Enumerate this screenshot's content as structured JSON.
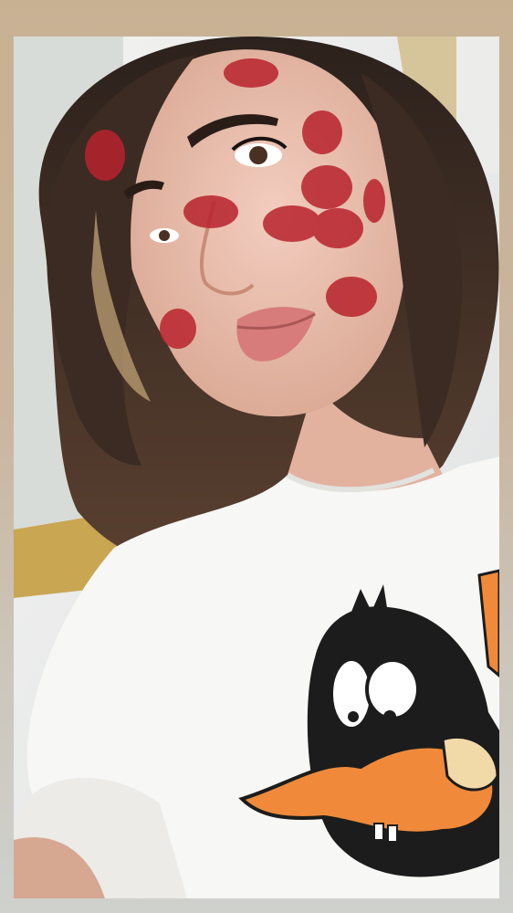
{
  "story": {
    "photo": {
      "kind": "selfie-photo",
      "effects": [
        "lipstick-kiss-marks"
      ],
      "shirt_graphic": "cartoon-duck"
    },
    "colors": {
      "border_top": "#c8b193",
      "border_bottom": "#cfd1cd",
      "hair": "#3a2a22",
      "skin": "#edc4b3",
      "kiss_mark": "#b8232d",
      "shirt": "#f7f7f5",
      "duck_black": "#1c1c1c",
      "duck_beak": "#f08a3a",
      "window_frame": "#c9a652"
    }
  }
}
